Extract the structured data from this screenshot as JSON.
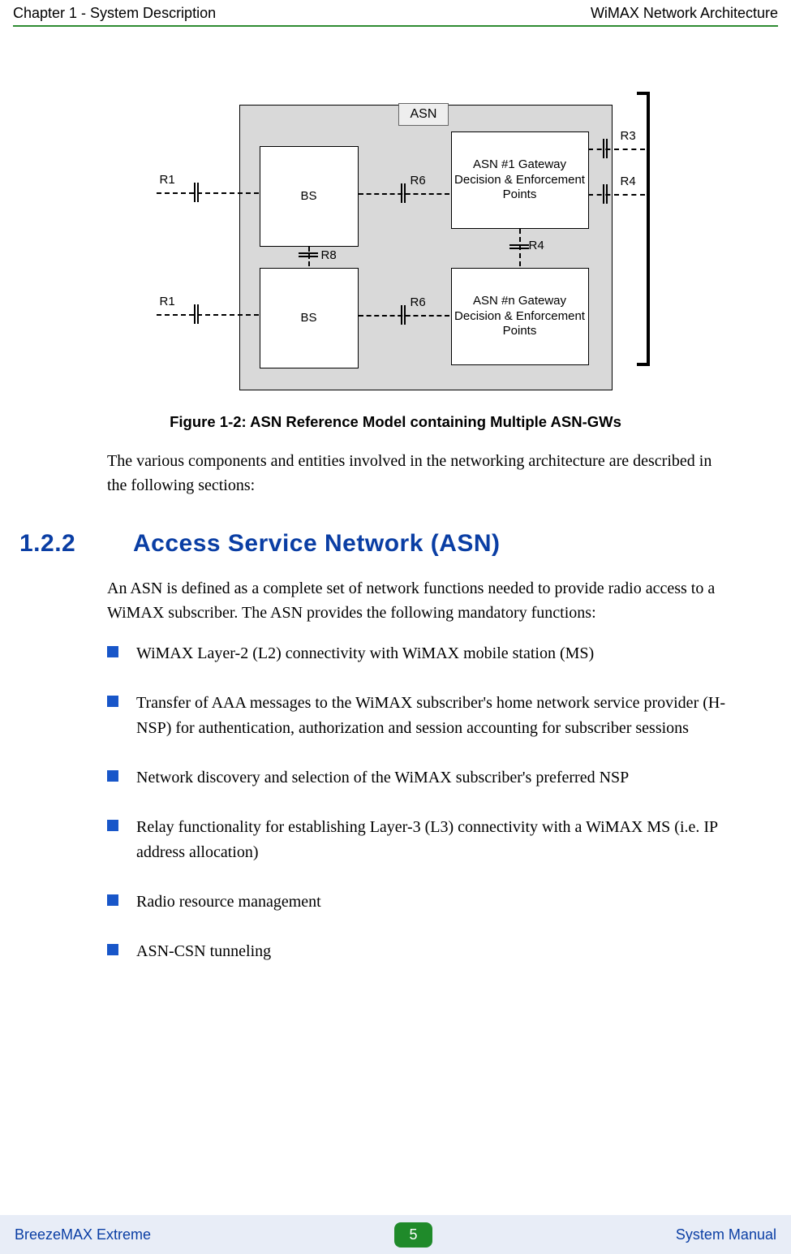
{
  "header": {
    "left": "Chapter 1 - System Description",
    "right": "WiMAX Network Architecture"
  },
  "diagram": {
    "container_label": "ASN",
    "nodes": {
      "bs1": "BS",
      "bs2": "BS",
      "gw1": "ASN #1 Gateway Decision & Enforcement Points",
      "gw2": "ASN #n Gateway Decision & Enforcement Points"
    },
    "labels": {
      "r1a": "R1",
      "r1b": "R1",
      "r6a": "R6",
      "r6b": "R6",
      "r8": "R8",
      "r4": "R4",
      "r3": "R3",
      "r4_ext": "R4"
    }
  },
  "figure_caption": "Figure 1-2: ASN Reference Model containing Multiple ASN-GWs",
  "intro_para": "The various components and entities involved in the networking architecture are described in the following sections:",
  "section": {
    "number": "1.2.2",
    "title": "Access Service Network (ASN)"
  },
  "section_para": "An ASN is defined as a complete set of network functions needed to provide radio access to a WiMAX subscriber. The ASN provides the following mandatory functions:",
  "bullets": [
    "WiMAX Layer-2 (L2) connectivity with WiMAX mobile station (MS)",
    "Transfer of AAA messages to the WiMAX subscriber's home network service provider (H-NSP) for authentication, authorization and session accounting for subscriber sessions",
    "Network discovery and selection of the WiMAX subscriber's preferred NSP",
    "Relay functionality for establishing Layer-3 (L3) connectivity with a WiMAX MS (i.e. IP address allocation)",
    "Radio resource management",
    "ASN-CSN tunneling"
  ],
  "footer": {
    "left": "BreezeMAX Extreme",
    "page": "5",
    "right": "System Manual"
  }
}
